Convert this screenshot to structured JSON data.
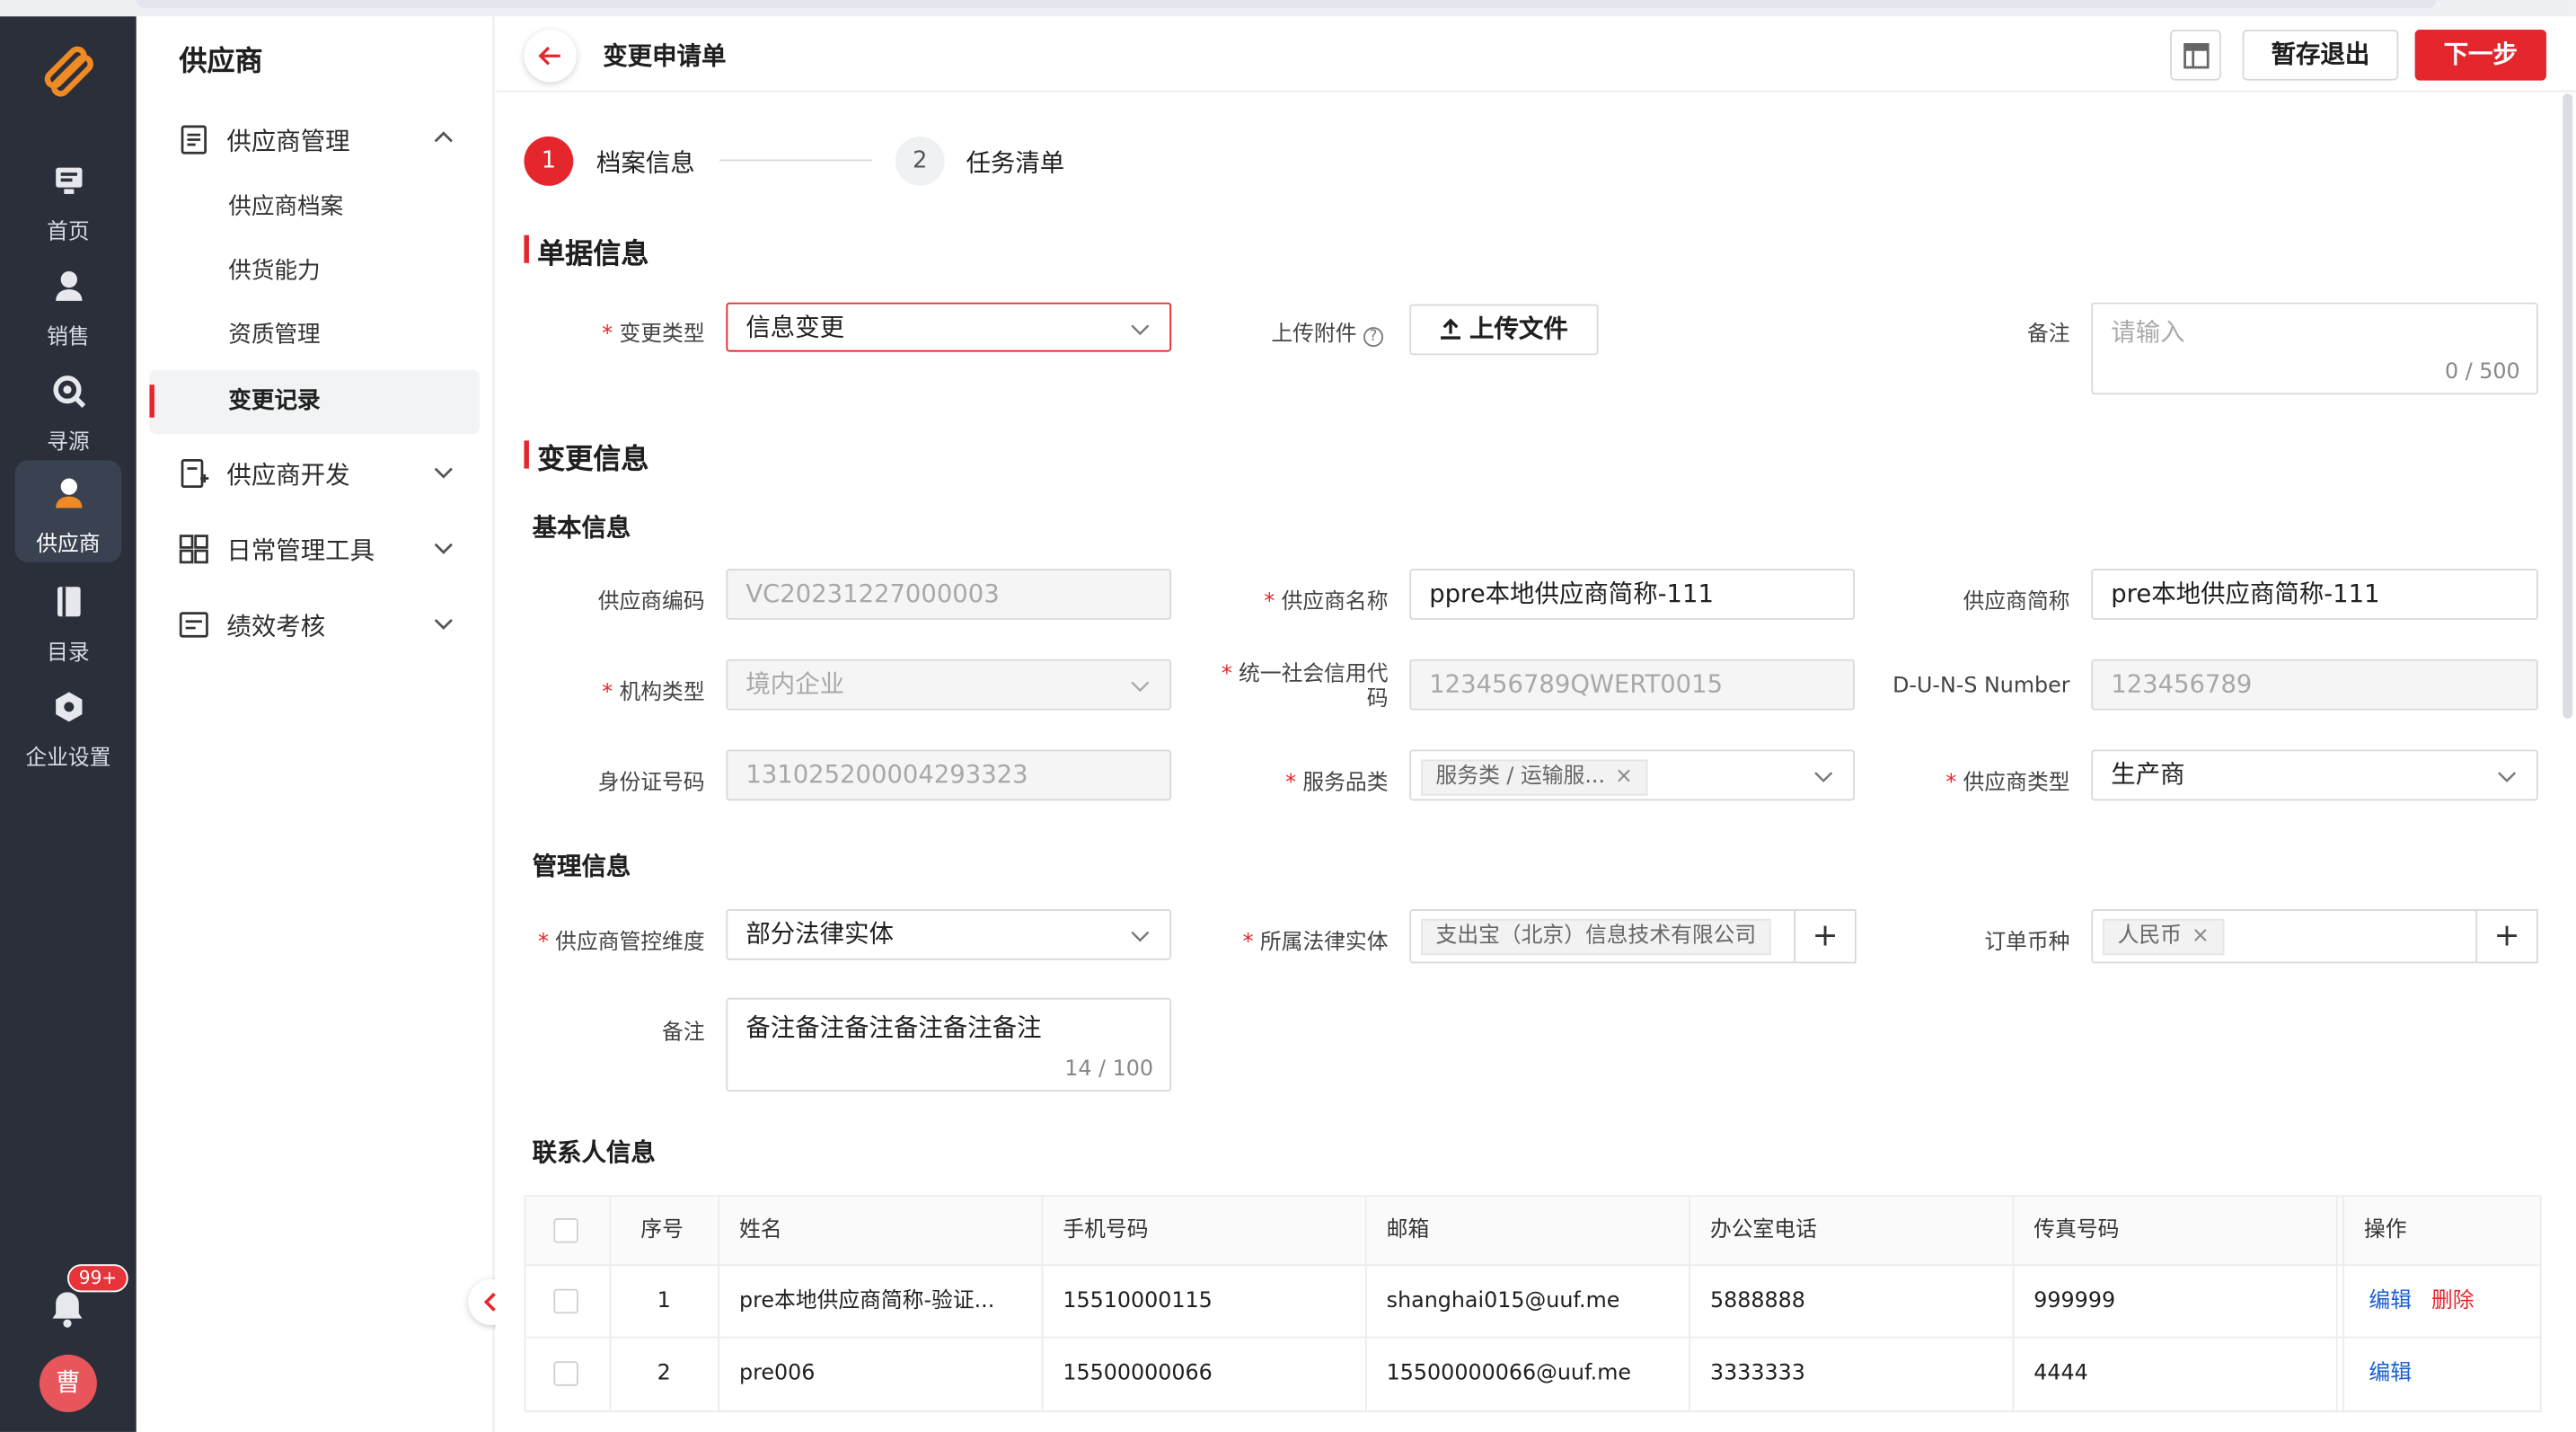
{
  "rail": {
    "items": [
      {
        "label": "首页"
      },
      {
        "label": "销售"
      },
      {
        "label": "寻源"
      },
      {
        "label": "供应商"
      },
      {
        "label": "目录"
      },
      {
        "label": "企业设置"
      }
    ],
    "badge": "99+",
    "avatar": "曹"
  },
  "sidebar": {
    "title": "供应商",
    "group_manage": "供应商管理",
    "sub_items": [
      "供应商档案",
      "供货能力",
      "资质管理",
      "变更记录"
    ],
    "group_dev": "供应商开发",
    "group_tools": "日常管理工具",
    "group_perf": "绩效考核"
  },
  "header": {
    "title": "变更申请单",
    "save_label": "暂存退出",
    "next_label": "下一步"
  },
  "steps": [
    {
      "num": "1",
      "label": "档案信息"
    },
    {
      "num": "2",
      "label": "任务清单"
    }
  ],
  "doc": {
    "section_title": "单据信息",
    "change_type_label": "变更类型",
    "change_type_value": "信息变更",
    "attach_label": "上传附件",
    "upload_label": "上传文件",
    "remark_label": "备注",
    "remark_placeholder": "请输入",
    "remark_count": "0 / 500"
  },
  "change": {
    "section_title": "变更信息",
    "basic_title": "基本信息",
    "code_label": "供应商编码",
    "code_value": "VC20231227000003",
    "name_label": "供应商名称",
    "name_value": "ppre本地供应商简称-111",
    "short_label": "供应商简称",
    "short_value": "pre本地供应商简称-111",
    "org_type_label": "机构类型",
    "org_type_value": "境内企业",
    "credit_label": "统一社会信用代码",
    "credit_value": "123456789QWERT0015",
    "duns_label": "D-U-N-S Number",
    "duns_value": "123456789",
    "id_label": "身份证号码",
    "id_value": "131025200004293323",
    "category_label": "服务品类",
    "category_tag": "服务类 / 运输服...",
    "supplier_type_label": "供应商类型",
    "supplier_type_value": "生产商",
    "mgmt_title": "管理信息",
    "dimension_label": "供应商管控维度",
    "dimension_value": "部分法律实体",
    "entity_label": "所属法律实体",
    "entity_tag": "支出宝（北京）信息技术有限公司",
    "currency_label": "订单币种",
    "currency_tag": "人民币",
    "note_label": "备注",
    "note_value": "备注备注备注备注备注备注",
    "note_count": "14 / 100"
  },
  "contacts": {
    "title": "联系人信息",
    "columns": [
      "序号",
      "姓名",
      "手机号码",
      "邮箱",
      "办公室电话",
      "传真号码",
      "操作"
    ],
    "rows": [
      {
        "no": "1",
        "name": "pre本地供应商简称-验证...",
        "mobile": "15510000115",
        "email": "shanghai015@uuf.me",
        "office": "5888888",
        "fax": "999999",
        "edit": "编辑",
        "delete": "删除"
      },
      {
        "no": "2",
        "name": "pre006",
        "mobile": "15500000066",
        "email": "15500000066@uuf.me",
        "office": "3333333",
        "fax": "4444",
        "edit": "编辑"
      }
    ]
  },
  "colors": {
    "accent": "#e6262d",
    "rail_bg": "#2a2f3a",
    "link": "#1a5fd6"
  }
}
